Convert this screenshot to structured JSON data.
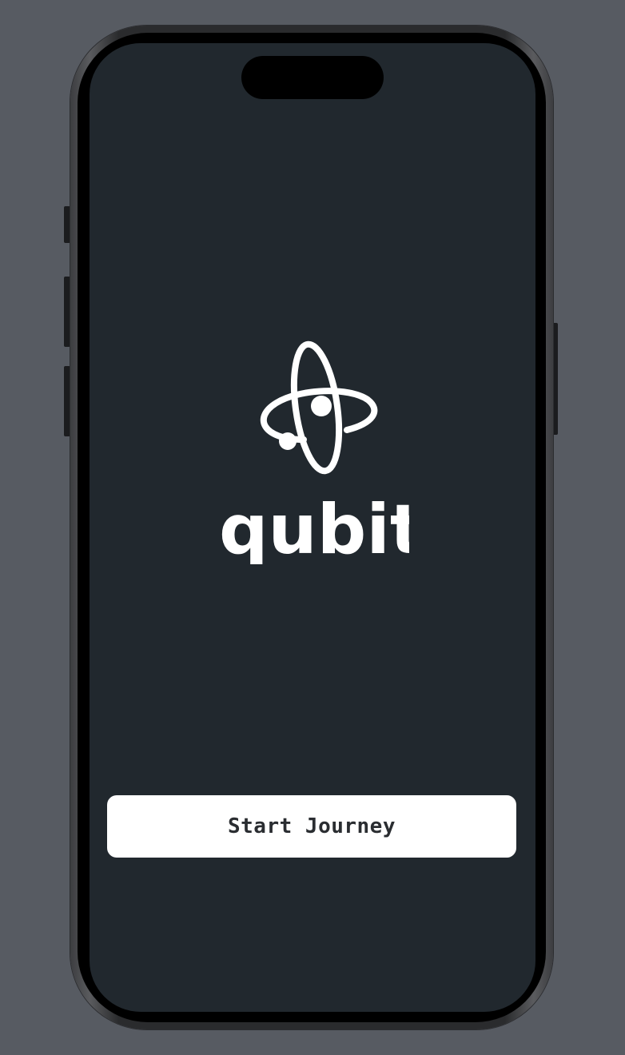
{
  "app": {
    "brand_name": "qubit"
  },
  "actions": {
    "start_label": "Start Journey"
  },
  "colors": {
    "background": "#575b62",
    "screen": "#21282e",
    "button": "#ffffff",
    "button_text": "#2a2d31",
    "logo": "#ffffff"
  },
  "icons": {
    "logo_mark": "atom-orbit-icon"
  }
}
